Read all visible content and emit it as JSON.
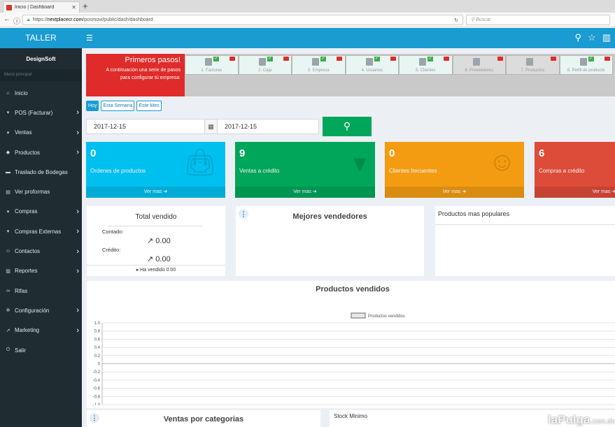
{
  "browser": {
    "tab_title": "Inicio | Dashboard",
    "url_prefix": "https://",
    "url_host": "nextplacecr.com",
    "url_path": "/posmovi/public/dash/dashboard",
    "search_placeholder": "Buscar"
  },
  "sidebar": {
    "brand": "TALLER",
    "user": "DesignSoft",
    "menu_header": "Menú principal",
    "items": [
      {
        "label": "Inicio",
        "icon": "home-icon",
        "has_submenu": false
      },
      {
        "label": "POS (Facturar)",
        "icon": "cart-icon",
        "has_submenu": true
      },
      {
        "label": "Ventas",
        "icon": "cart-icon",
        "has_submenu": true
      },
      {
        "label": "Productos",
        "icon": "cubes-icon",
        "has_submenu": true
      },
      {
        "label": "Traslado de Bodegas",
        "icon": "truck-icon",
        "has_submenu": false
      },
      {
        "label": "Ver proformas",
        "icon": "file-icon",
        "has_submenu": false
      },
      {
        "label": "Compras",
        "icon": "cart-icon",
        "has_submenu": true
      },
      {
        "label": "Compras Externas",
        "icon": "cart-icon",
        "has_submenu": true
      },
      {
        "label": "Contactos",
        "icon": "users-icon",
        "has_submenu": true
      },
      {
        "label": "Reportes",
        "icon": "bar-chart-icon",
        "has_submenu": true
      },
      {
        "label": "Rifas",
        "icon": "link-icon",
        "has_submenu": false
      },
      {
        "label": "Configuración",
        "icon": "gear-icon",
        "has_submenu": true
      },
      {
        "label": "Marketing",
        "icon": "line-chart-icon",
        "has_submenu": true
      },
      {
        "label": "Salir",
        "icon": "power-icon",
        "has_submenu": false
      }
    ]
  },
  "wizard": {
    "title": "Primeros pasos!",
    "subtitle_line1": "A continuación una serie de pasos",
    "subtitle_line2": "para configurar tú empresa:",
    "steps": [
      {
        "label": "1. Facturas",
        "done": true
      },
      {
        "label": "2. Caja",
        "done": true
      },
      {
        "label": "3. Empresa",
        "done": true
      },
      {
        "label": "4. Usuarios",
        "done": true
      },
      {
        "label": "5. Clientes",
        "done": true
      },
      {
        "label": "6. Proveedores",
        "done": false
      },
      {
        "label": "7. Productos",
        "done": false
      },
      {
        "label": "8. Perfil de producto",
        "done": true
      }
    ]
  },
  "filters": {
    "today": "Hoy",
    "week": "Esta Semana",
    "month": "Este Mes",
    "date_from": "2017-12-15",
    "date_to": "2017-12-15"
  },
  "stats": [
    {
      "value": "0",
      "label": "Ordenes de productos",
      "more": "Ver mas",
      "color": "#00c0ef",
      "icon": "bag-icon"
    },
    {
      "value": "9",
      "label": "Ventas a crédito",
      "more": "Ver mas",
      "color": "#00a65a",
      "icon": "cart-icon"
    },
    {
      "value": "0",
      "label": "Clientes frecuentes",
      "more": "Ver mas",
      "color": "#f39c12",
      "icon": "users-icon"
    },
    {
      "value": "6",
      "label": "Compras a crédito",
      "more": "Ver mas",
      "color": "#dd4b39",
      "icon": "cart-icon"
    }
  ],
  "total_vendido": {
    "title": "Total vendido",
    "contado_label": "Contado:",
    "contado_value": "0.00",
    "credito_label": "Crédito:",
    "credito_value": "0.00",
    "footer": "Ha vendido 0.00"
  },
  "mejores_vendedores": {
    "title": "Mejores vendedores"
  },
  "productos_populares": {
    "title": "Productos mas populares"
  },
  "chart_data": {
    "type": "line",
    "title": "Productos vendidos",
    "series": [
      {
        "name": "Productos vendidos",
        "values": []
      }
    ],
    "yticks": [
      "1.0",
      "0.8",
      "0.6",
      "0.4",
      "0.2",
      "0",
      "-0.2",
      "-0.4",
      "-0.6",
      "-0.8",
      "-1.0"
    ],
    "ylim": [
      -1.0,
      1.0
    ],
    "grid": true,
    "legend": "top-center"
  },
  "ventas_categorias": {
    "title": "Ventas por categorias"
  },
  "stock_minimo": {
    "title": "Stock Minimo"
  },
  "watermark": {
    "brand": "laPulga",
    "suffix": ".com.do"
  }
}
